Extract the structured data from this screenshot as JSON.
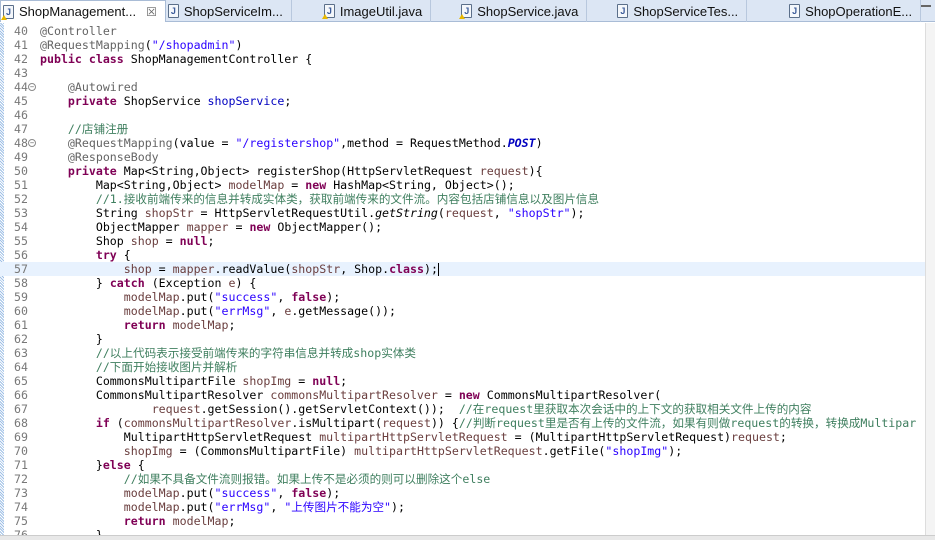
{
  "tabs": [
    {
      "label": "ShopManagement...",
      "active": true,
      "close": "☒",
      "icon": "java-file-warning-icon"
    },
    {
      "label": "ShopServiceIm...",
      "icon": "java-file-icon"
    },
    {
      "label": "ImageUtil.java",
      "icon": "java-file-warning-icon"
    },
    {
      "label": "ShopService.java",
      "icon": "java-file-warning-icon"
    },
    {
      "label": "ShopServiceTes...",
      "icon": "java-file-icon"
    },
    {
      "label": "ShopOperationE...",
      "icon": "java-file-icon"
    }
  ],
  "colors": {
    "keyword": "#7f0055",
    "string": "#2a00ff",
    "comment": "#3f7f5f",
    "annotation": "#646464",
    "field": "#0000c0",
    "local": "#6a3e3e",
    "current_line": "#e8f2fe"
  },
  "editor": {
    "current_line": 57,
    "lines": [
      {
        "n": "40",
        "seg": [
          [
            "a",
            "@Controller"
          ]
        ]
      },
      {
        "n": "41",
        "seg": [
          [
            "a",
            "@RequestMapping"
          ],
          [
            "p",
            "("
          ],
          [
            "s",
            "\"/shopadmin\""
          ],
          [
            "p",
            ")"
          ]
        ]
      },
      {
        "n": "42",
        "seg": [
          [
            "k",
            "public class "
          ],
          [
            "p",
            "ShopManagementController {"
          ]
        ]
      },
      {
        "n": "43",
        "seg": []
      },
      {
        "n": "44",
        "fold": true,
        "seg": [
          [
            "p",
            "    "
          ],
          [
            "a",
            "@Autowired"
          ]
        ]
      },
      {
        "n": "45",
        "seg": [
          [
            "p",
            "    "
          ],
          [
            "k",
            "private "
          ],
          [
            "p",
            "ShopService "
          ],
          [
            "f",
            "shopService"
          ],
          [
            "p",
            ";"
          ]
        ]
      },
      {
        "n": "46",
        "seg": []
      },
      {
        "n": "47",
        "seg": [
          [
            "p",
            "    "
          ],
          [
            "c",
            "//店铺注册"
          ]
        ]
      },
      {
        "n": "48",
        "fold": true,
        "seg": [
          [
            "p",
            "    "
          ],
          [
            "a",
            "@RequestMapping"
          ],
          [
            "p",
            "(value = "
          ],
          [
            "s",
            "\"/registershop\""
          ],
          [
            "p",
            ",method = RequestMethod."
          ],
          [
            "n",
            "POST"
          ],
          [
            "p",
            ")"
          ]
        ]
      },
      {
        "n": "49",
        "seg": [
          [
            "p",
            "    "
          ],
          [
            "a",
            "@ResponseBody"
          ]
        ]
      },
      {
        "n": "50",
        "seg": [
          [
            "p",
            "    "
          ],
          [
            "k",
            "private "
          ],
          [
            "p",
            "Map<String,Object> registerShop(HttpServletRequest "
          ],
          [
            "v",
            "request"
          ],
          [
            "p",
            "){"
          ]
        ]
      },
      {
        "n": "51",
        "seg": [
          [
            "p",
            "        Map<String,Object> "
          ],
          [
            "v",
            "modelMap"
          ],
          [
            "p",
            " = "
          ],
          [
            "k",
            "new"
          ],
          [
            "p",
            " HashMap<String, Object>();"
          ]
        ]
      },
      {
        "n": "52",
        "seg": [
          [
            "p",
            "        "
          ],
          [
            "c",
            "//1.接收前端传来的信息并转成实体类，获取前端传来的文件流。内容包括店铺信息以及图片信息"
          ]
        ]
      },
      {
        "n": "53",
        "seg": [
          [
            "p",
            "        String "
          ],
          [
            "v",
            "shopStr"
          ],
          [
            "p",
            " = HttpServletRequestUtil."
          ],
          [
            "i",
            "getString"
          ],
          [
            "p",
            "("
          ],
          [
            "v",
            "request"
          ],
          [
            "p",
            ", "
          ],
          [
            "s",
            "\"shopStr\""
          ],
          [
            "p",
            ");"
          ]
        ]
      },
      {
        "n": "54",
        "seg": [
          [
            "p",
            "        ObjectMapper "
          ],
          [
            "v",
            "mapper"
          ],
          [
            "p",
            " = "
          ],
          [
            "k",
            "new"
          ],
          [
            "p",
            " ObjectMapper();"
          ]
        ]
      },
      {
        "n": "55",
        "seg": [
          [
            "p",
            "        Shop "
          ],
          [
            "v",
            "shop"
          ],
          [
            "p",
            " = "
          ],
          [
            "k",
            "null"
          ],
          [
            "p",
            ";"
          ]
        ]
      },
      {
        "n": "56",
        "seg": [
          [
            "p",
            "        "
          ],
          [
            "k",
            "try"
          ],
          [
            "p",
            " {"
          ]
        ]
      },
      {
        "n": "57",
        "seg": [
          [
            "p",
            "            "
          ],
          [
            "v",
            "shop"
          ],
          [
            "p",
            " = "
          ],
          [
            "v",
            "mapper"
          ],
          [
            "p",
            ".readValue("
          ],
          [
            "v",
            "shopStr"
          ],
          [
            "p",
            ", Shop."
          ],
          [
            "k",
            "class"
          ],
          [
            "p",
            ");"
          ]
        ]
      },
      {
        "n": "58",
        "seg": [
          [
            "p",
            "        } "
          ],
          [
            "k",
            "catch"
          ],
          [
            "p",
            " (Exception "
          ],
          [
            "v",
            "e"
          ],
          [
            "p",
            ") {"
          ]
        ]
      },
      {
        "n": "59",
        "seg": [
          [
            "p",
            "            "
          ],
          [
            "v",
            "modelMap"
          ],
          [
            "p",
            ".put("
          ],
          [
            "s",
            "\"success\""
          ],
          [
            "p",
            ", "
          ],
          [
            "k",
            "false"
          ],
          [
            "p",
            ");"
          ]
        ]
      },
      {
        "n": "60",
        "seg": [
          [
            "p",
            "            "
          ],
          [
            "v",
            "modelMap"
          ],
          [
            "p",
            ".put("
          ],
          [
            "s",
            "\"errMsg\""
          ],
          [
            "p",
            ", "
          ],
          [
            "v",
            "e"
          ],
          [
            "p",
            ".getMessage());"
          ]
        ]
      },
      {
        "n": "61",
        "seg": [
          [
            "p",
            "            "
          ],
          [
            "k",
            "return "
          ],
          [
            "v",
            "modelMap"
          ],
          [
            "p",
            ";"
          ]
        ]
      },
      {
        "n": "62",
        "seg": [
          [
            "p",
            "        }"
          ]
        ]
      },
      {
        "n": "63",
        "seg": [
          [
            "p",
            "        "
          ],
          [
            "c",
            "//以上代码表示接受前端传来的字符串信息并转成shop实体类"
          ]
        ]
      },
      {
        "n": "64",
        "seg": [
          [
            "p",
            "        "
          ],
          [
            "c",
            "//下面开始接收图片并解析"
          ]
        ]
      },
      {
        "n": "65",
        "seg": [
          [
            "p",
            "        CommonsMultipartFile "
          ],
          [
            "v",
            "shopImg"
          ],
          [
            "p",
            " = "
          ],
          [
            "k",
            "null"
          ],
          [
            "p",
            ";"
          ]
        ]
      },
      {
        "n": "66",
        "seg": [
          [
            "p",
            "        CommonsMultipartResolver "
          ],
          [
            "v",
            "commonsMultipartResolver"
          ],
          [
            "p",
            " = "
          ],
          [
            "k",
            "new"
          ],
          [
            "p",
            " CommonsMultipartResolver("
          ]
        ]
      },
      {
        "n": "67",
        "seg": [
          [
            "p",
            "                "
          ],
          [
            "v",
            "request"
          ],
          [
            "p",
            ".getSession().getServletContext());  "
          ],
          [
            "c",
            "//在request里获取本次会话中的上下文的获取相关文件上传的内容"
          ]
        ]
      },
      {
        "n": "68",
        "seg": [
          [
            "p",
            "        "
          ],
          [
            "k",
            "if"
          ],
          [
            "p",
            " ("
          ],
          [
            "v",
            "commonsMultipartResolver"
          ],
          [
            "p",
            ".isMultipart("
          ],
          [
            "v",
            "request"
          ],
          [
            "p",
            ")) {"
          ],
          [
            "c",
            "//判断request里是否有上传的文件流，如果有则做request的转换，转换成Multipar"
          ]
        ]
      },
      {
        "n": "69",
        "seg": [
          [
            "p",
            "            MultipartHttpServletRequest "
          ],
          [
            "v",
            "multipartHttpServletRequest"
          ],
          [
            "p",
            " = (MultipartHttpServletRequest)"
          ],
          [
            "v",
            "request"
          ],
          [
            "p",
            ";"
          ]
        ]
      },
      {
        "n": "70",
        "seg": [
          [
            "p",
            "            "
          ],
          [
            "v",
            "shopImg"
          ],
          [
            "p",
            " = (CommonsMultipartFile) "
          ],
          [
            "v",
            "multipartHttpServletRequest"
          ],
          [
            "p",
            ".getFile("
          ],
          [
            "s",
            "\"shopImg\""
          ],
          [
            "p",
            ");"
          ]
        ]
      },
      {
        "n": "71",
        "seg": [
          [
            "p",
            "        }"
          ],
          [
            "k",
            "else"
          ],
          [
            "p",
            " {"
          ]
        ]
      },
      {
        "n": "72",
        "seg": [
          [
            "p",
            "            "
          ],
          [
            "c",
            "//如果不具备文件流则报错。如果上传不是必须的则可以删除这个else"
          ]
        ]
      },
      {
        "n": "73",
        "seg": [
          [
            "p",
            "            "
          ],
          [
            "v",
            "modelMap"
          ],
          [
            "p",
            ".put("
          ],
          [
            "s",
            "\"success\""
          ],
          [
            "p",
            ", "
          ],
          [
            "k",
            "false"
          ],
          [
            "p",
            ");"
          ]
        ]
      },
      {
        "n": "74",
        "seg": [
          [
            "p",
            "            "
          ],
          [
            "v",
            "modelMap"
          ],
          [
            "p",
            ".put("
          ],
          [
            "s",
            "\"errMsg\""
          ],
          [
            "p",
            ", "
          ],
          [
            "s",
            "\"上传图片不能为空\""
          ],
          [
            "p",
            ");"
          ]
        ]
      },
      {
        "n": "75",
        "seg": [
          [
            "p",
            "            "
          ],
          [
            "k",
            "return "
          ],
          [
            "v",
            "modelMap"
          ],
          [
            "p",
            ";"
          ]
        ]
      },
      {
        "n": "76",
        "seg": [
          [
            "p",
            "        }"
          ]
        ]
      }
    ]
  }
}
